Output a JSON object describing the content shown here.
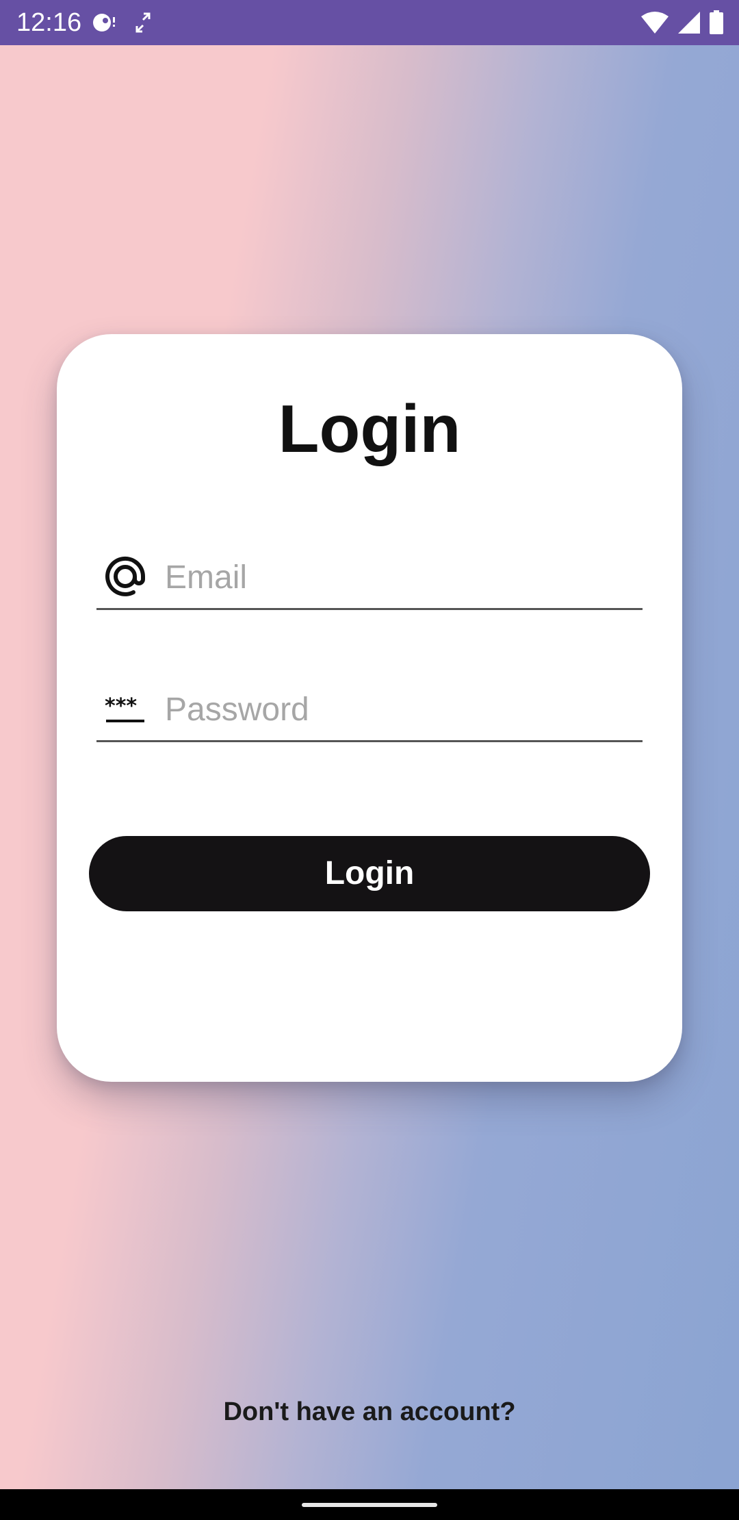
{
  "status_bar": {
    "time": "12:16",
    "background_color": "#6650a4",
    "left_icons": [
      "media-disc-icon",
      "fullscreen-arrows-icon"
    ],
    "right_icons": [
      "wifi-icon",
      "cell-signal-icon",
      "battery-icon"
    ]
  },
  "login_card": {
    "title": "Login",
    "email_field": {
      "icon": "at-sign-icon",
      "placeholder": "Email",
      "value": ""
    },
    "password_field": {
      "icon": "password-dots-icon",
      "placeholder": "Password",
      "value": ""
    },
    "login_button_label": "Login",
    "button_color": "#141214"
  },
  "signup_link": "Don't have an account?",
  "background_gradient": [
    "#f7c9cc",
    "#8ba4d2"
  ]
}
